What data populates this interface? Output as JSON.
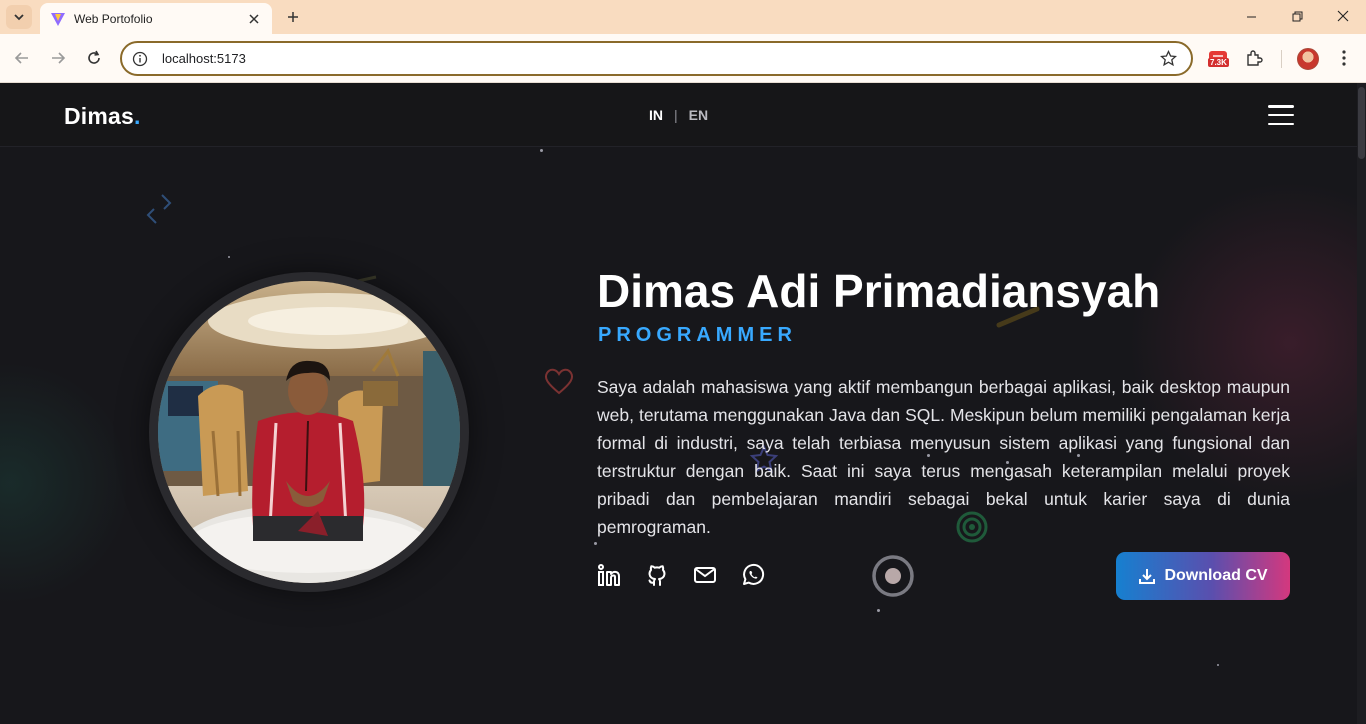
{
  "browser": {
    "tab_title": "Web Portofolio",
    "url": "localhost:5173",
    "extension_badge": "7.3K"
  },
  "navbar": {
    "brand": "Dimas",
    "brand_dot": ".",
    "lang_in": "IN",
    "lang_sep": "|",
    "lang_en": "EN"
  },
  "hero": {
    "name": "Dimas Adi Primadiansyah",
    "role": "PROGRAMMER",
    "description": "Saya adalah mahasiswa yang aktif membangun berbagai aplikasi, baik desktop maupun web, terutama menggunakan Java dan SQL. Meskipun belum memiliki pengalaman kerja formal di industri, saya telah terbiasa menyusun sistem aplikasi yang fungsional dan terstruktur dengan baik. Saat ini saya terus mengasah keterampilan melalui proyek pribadi dan pembelajaran mandiri sebagai bekal untuk karier saya di dunia pemrograman.",
    "download_label": "Download CV",
    "socials": [
      "linkedin-icon",
      "github-icon",
      "mail-icon",
      "whatsapp-icon"
    ]
  },
  "colors": {
    "accent": "#38a9ff",
    "background": "#17171b",
    "tabbar": "#f9dcc0",
    "button_gradient": [
      "#1680d0",
      "#d4387e"
    ]
  }
}
